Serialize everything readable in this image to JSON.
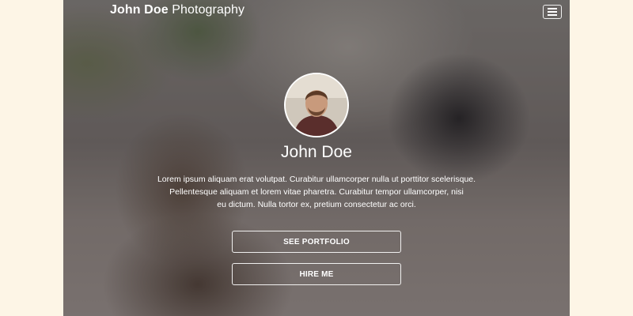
{
  "header": {
    "brand_bold": "John Doe",
    "brand_light": "Photography",
    "menu_icon": "hamburger-menu-icon"
  },
  "profile": {
    "avatar_icon": "profile-photo",
    "name": "John Doe",
    "bio_line1": "Lorem ipsum aliquam erat volutpat. Curabitur ullamcorper nulla ut porttitor scelerisque.",
    "bio_line2": "Pellentesque aliquam et lorem vitae pharetra. Curabitur tempor ullamcorper, nisi",
    "bio_line3": "eu dictum. Nulla tortor ex, pretium consectetur ac orci."
  },
  "actions": {
    "portfolio_label": "SEE PORTFOLIO",
    "hire_label": "HIRE ME"
  },
  "colors": {
    "outer_background": "#fdf5e6",
    "text": "#ffffff"
  }
}
